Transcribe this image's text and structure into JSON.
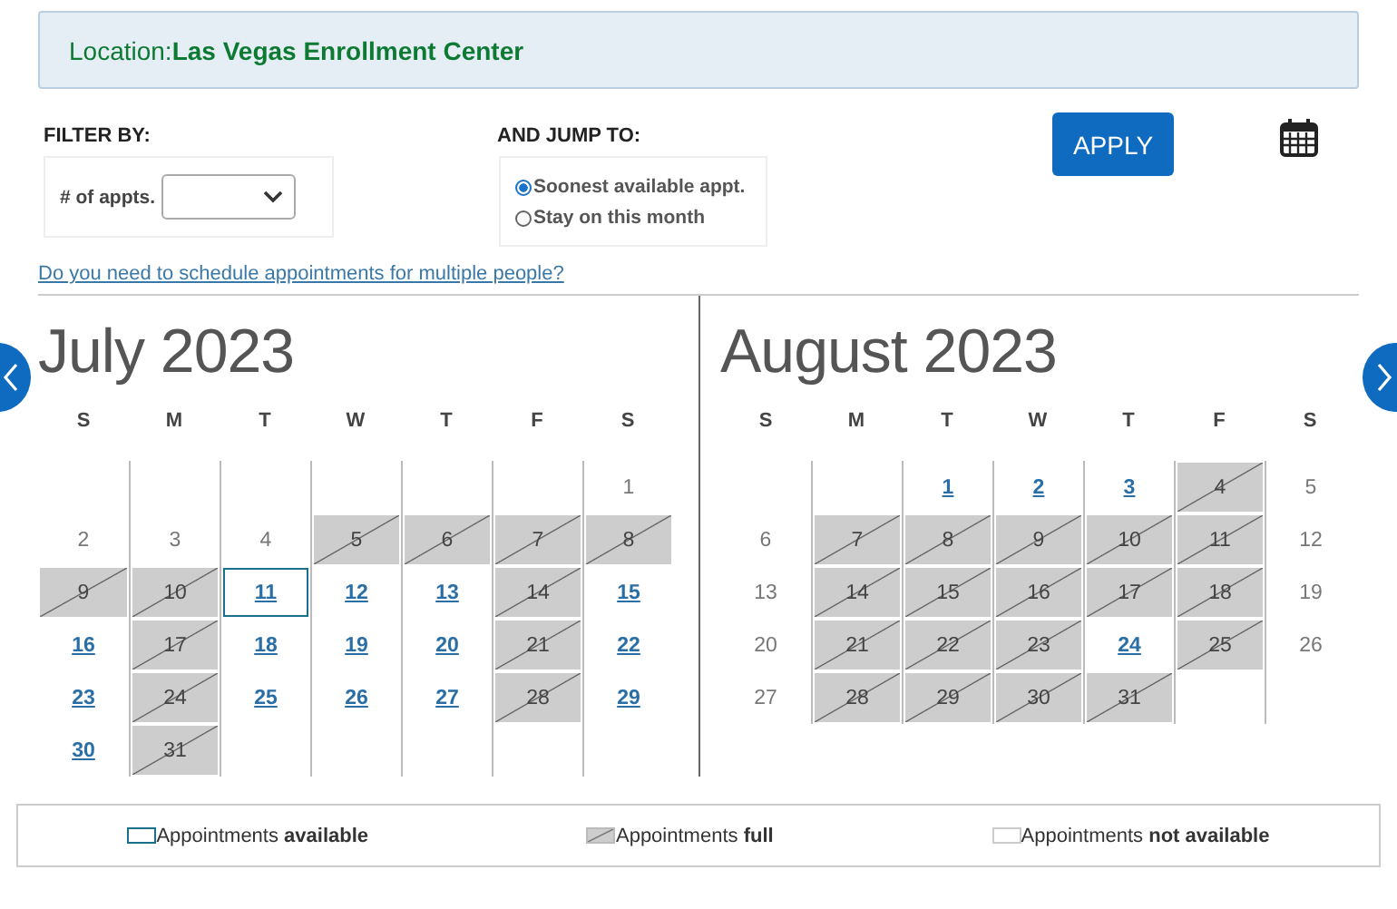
{
  "location": {
    "text": "Location:**Las Vegas Enrollment Center**"
  },
  "filter": {
    "heading": "FILTER BY:",
    "label": "# of appts."
  },
  "jump": {
    "heading": "AND JUMP TO:",
    "options": [
      {
        "label": "Soonest available appt.",
        "selected": true
      },
      {
        "label": "Stay on this month",
        "selected": false
      }
    ]
  },
  "apply_button": "APPLY",
  "multiple_people_link": "Do you need to schedule appointments for multiple people?",
  "months": [
    {
      "title": "July 2023",
      "weekdays": [
        "S",
        "M",
        "T",
        "W",
        "T",
        "F",
        "S"
      ],
      "weeks": [
        [
          {
            "kind": "blank"
          },
          {
            "kind": "blank"
          },
          {
            "kind": "blank"
          },
          {
            "kind": "blank"
          },
          {
            "kind": "blank"
          },
          {
            "kind": "blank"
          },
          {
            "kind": "none",
            "day": "1",
            "selected": false
          }
        ],
        [
          {
            "kind": "none",
            "day": "2",
            "selected": false
          },
          {
            "kind": "none",
            "day": "3",
            "selected": false
          },
          {
            "kind": "none",
            "day": "4",
            "selected": false
          },
          {
            "kind": "full",
            "day": "5",
            "selected": false
          },
          {
            "kind": "full",
            "day": "6",
            "selected": false
          },
          {
            "kind": "full",
            "day": "7",
            "selected": false
          },
          {
            "kind": "full",
            "day": "8",
            "selected": false
          }
        ],
        [
          {
            "kind": "full",
            "day": "9",
            "selected": false
          },
          {
            "kind": "full",
            "day": "10",
            "selected": false
          },
          {
            "kind": "available",
            "day": "11",
            "selected": true
          },
          {
            "kind": "available",
            "day": "12",
            "selected": false
          },
          {
            "kind": "available",
            "day": "13",
            "selected": false
          },
          {
            "kind": "full",
            "day": "14",
            "selected": false
          },
          {
            "kind": "available",
            "day": "15",
            "selected": false
          }
        ],
        [
          {
            "kind": "available",
            "day": "16",
            "selected": false
          },
          {
            "kind": "full",
            "day": "17",
            "selected": false
          },
          {
            "kind": "available",
            "day": "18",
            "selected": false
          },
          {
            "kind": "available",
            "day": "19",
            "selected": false
          },
          {
            "kind": "available",
            "day": "20",
            "selected": false
          },
          {
            "kind": "full",
            "day": "21",
            "selected": false
          },
          {
            "kind": "available",
            "day": "22",
            "selected": false
          }
        ],
        [
          {
            "kind": "available",
            "day": "23",
            "selected": false
          },
          {
            "kind": "full",
            "day": "24",
            "selected": false
          },
          {
            "kind": "available",
            "day": "25",
            "selected": false
          },
          {
            "kind": "available",
            "day": "26",
            "selected": false
          },
          {
            "kind": "available",
            "day": "27",
            "selected": false
          },
          {
            "kind": "full",
            "day": "28",
            "selected": false
          },
          {
            "kind": "available",
            "day": "29",
            "selected": false
          }
        ],
        [
          {
            "kind": "available",
            "day": "30",
            "selected": false
          },
          {
            "kind": "full",
            "day": "31",
            "selected": false
          },
          {
            "kind": "blank"
          },
          {
            "kind": "blank"
          },
          {
            "kind": "blank"
          },
          {
            "kind": "blank"
          },
          {
            "kind": "blank"
          }
        ]
      ]
    },
    {
      "title": "August 2023",
      "weekdays": [
        "S",
        "M",
        "T",
        "W",
        "T",
        "F",
        "S"
      ],
      "weeks": [
        [
          {
            "kind": "blank"
          },
          {
            "kind": "blank"
          },
          {
            "kind": "available",
            "day": "1",
            "selected": false
          },
          {
            "kind": "available",
            "day": "2",
            "selected": false
          },
          {
            "kind": "available",
            "day": "3",
            "selected": false
          },
          {
            "kind": "full",
            "day": "4",
            "selected": false
          },
          {
            "kind": "none",
            "day": "5",
            "selected": false
          }
        ],
        [
          {
            "kind": "none",
            "day": "6",
            "selected": false
          },
          {
            "kind": "full",
            "day": "7",
            "selected": false
          },
          {
            "kind": "full",
            "day": "8",
            "selected": false
          },
          {
            "kind": "full",
            "day": "9",
            "selected": false
          },
          {
            "kind": "full",
            "day": "10",
            "selected": false
          },
          {
            "kind": "full",
            "day": "11",
            "selected": false
          },
          {
            "kind": "none",
            "day": "12",
            "selected": false
          }
        ],
        [
          {
            "kind": "none",
            "day": "13",
            "selected": false
          },
          {
            "kind": "full",
            "day": "14",
            "selected": false
          },
          {
            "kind": "full",
            "day": "15",
            "selected": false
          },
          {
            "kind": "full",
            "day": "16",
            "selected": false
          },
          {
            "kind": "full",
            "day": "17",
            "selected": false
          },
          {
            "kind": "full",
            "day": "18",
            "selected": false
          },
          {
            "kind": "none",
            "day": "19",
            "selected": false
          }
        ],
        [
          {
            "kind": "none",
            "day": "20",
            "selected": false
          },
          {
            "kind": "full",
            "day": "21",
            "selected": false
          },
          {
            "kind": "full",
            "day": "22",
            "selected": false
          },
          {
            "kind": "full",
            "day": "23",
            "selected": false
          },
          {
            "kind": "available",
            "day": "24",
            "selected": false
          },
          {
            "kind": "full",
            "day": "25",
            "selected": false
          },
          {
            "kind": "none",
            "day": "26",
            "selected": false
          }
        ],
        [
          {
            "kind": "none",
            "day": "27",
            "selected": false
          },
          {
            "kind": "full",
            "day": "28",
            "selected": false
          },
          {
            "kind": "full",
            "day": "29",
            "selected": false
          },
          {
            "kind": "full",
            "day": "30",
            "selected": false
          },
          {
            "kind": "full",
            "day": "31",
            "selected": false
          },
          {
            "kind": "blank"
          },
          {
            "kind": "blank"
          }
        ]
      ]
    }
  ],
  "legend": [
    {
      "kind": "available",
      "text": "Appointments **available**"
    },
    {
      "kind": "full",
      "text": "Appointments **full**"
    },
    {
      "kind": "none",
      "text": "Appointments **not available**"
    }
  ]
}
